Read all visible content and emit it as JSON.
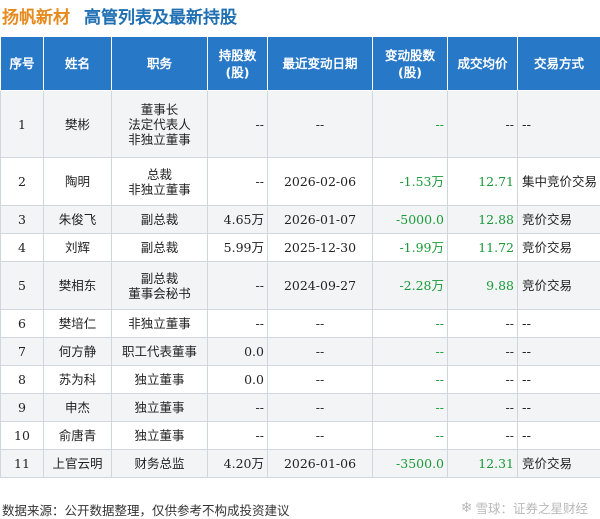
{
  "header": {
    "company": "扬帆新材",
    "subtitle": "高管列表及最新持股"
  },
  "columns": [
    "序号",
    "姓名",
    "职务",
    "持股数\n(股)",
    "最近变动日期",
    "变动股数\n(股)",
    "成交均价",
    "交易方式"
  ],
  "rows": [
    {
      "no": "1",
      "name": "樊彬",
      "position": "董事长\n法定代表人\n非独立董事",
      "holdings": "--",
      "date": "--",
      "change": "--",
      "price": "--",
      "method": "--"
    },
    {
      "no": "2",
      "name": "陶明",
      "position": "总裁\n非独立董事",
      "holdings": "--",
      "date": "2026-02-06",
      "change": "-1.53万",
      "price": "12.71",
      "method": "集中竞价交易"
    },
    {
      "no": "3",
      "name": "朱俊飞",
      "position": "副总裁",
      "holdings": "4.65万",
      "date": "2026-01-07",
      "change": "-5000.0",
      "price": "12.88",
      "method": "竞价交易"
    },
    {
      "no": "4",
      "name": "刘辉",
      "position": "副总裁",
      "holdings": "5.99万",
      "date": "2025-12-30",
      "change": "-1.99万",
      "price": "11.72",
      "method": "竞价交易"
    },
    {
      "no": "5",
      "name": "樊相东",
      "position": "副总裁\n董事会秘书",
      "holdings": "--",
      "date": "2024-09-27",
      "change": "-2.28万",
      "price": "9.88",
      "method": "竞价交易"
    },
    {
      "no": "6",
      "name": "樊培仁",
      "position": "非独立董事",
      "holdings": "--",
      "date": "--",
      "change": "--",
      "price": "--",
      "method": "--"
    },
    {
      "no": "7",
      "name": "何方静",
      "position": "职工代表董事",
      "holdings": "0.0",
      "date": "--",
      "change": "--",
      "price": "--",
      "method": "--"
    },
    {
      "no": "8",
      "name": "苏为科",
      "position": "独立董事",
      "holdings": "0.0",
      "date": "--",
      "change": "--",
      "price": "--",
      "method": "--"
    },
    {
      "no": "9",
      "name": "申杰",
      "position": "独立董事",
      "holdings": "--",
      "date": "--",
      "change": "--",
      "price": "--",
      "method": "--"
    },
    {
      "no": "10",
      "name": "俞唐青",
      "position": "独立董事",
      "holdings": "--",
      "date": "--",
      "change": "--",
      "price": "--",
      "method": "--"
    },
    {
      "no": "11",
      "name": "上官云明",
      "position": "财务总监",
      "holdings": "4.20万",
      "date": "2026-01-06",
      "change": "-3500.0",
      "price": "12.31",
      "method": "竞价交易"
    }
  ],
  "footer": {
    "source": "数据来源：公开数据整理，仅供参考不构成投资建议",
    "brand": "雪球：证券之星财经"
  },
  "watermark": "证券之星"
}
